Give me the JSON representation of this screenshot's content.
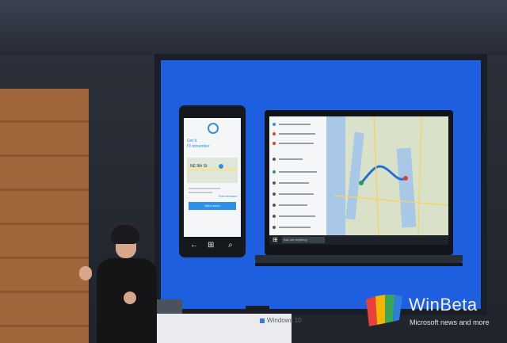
{
  "phone": {
    "title": "Get it.",
    "subtitle": "I'll remember",
    "map_label": "NE 8th St",
    "link": "Edit reminder",
    "button": "Add Lunch"
  },
  "laptop": {
    "search": "Ask me anything"
  },
  "podium": {
    "brand": "Windows 10"
  },
  "watermark": {
    "brand": "WinBeta",
    "tagline": "Microsoft news and more"
  }
}
